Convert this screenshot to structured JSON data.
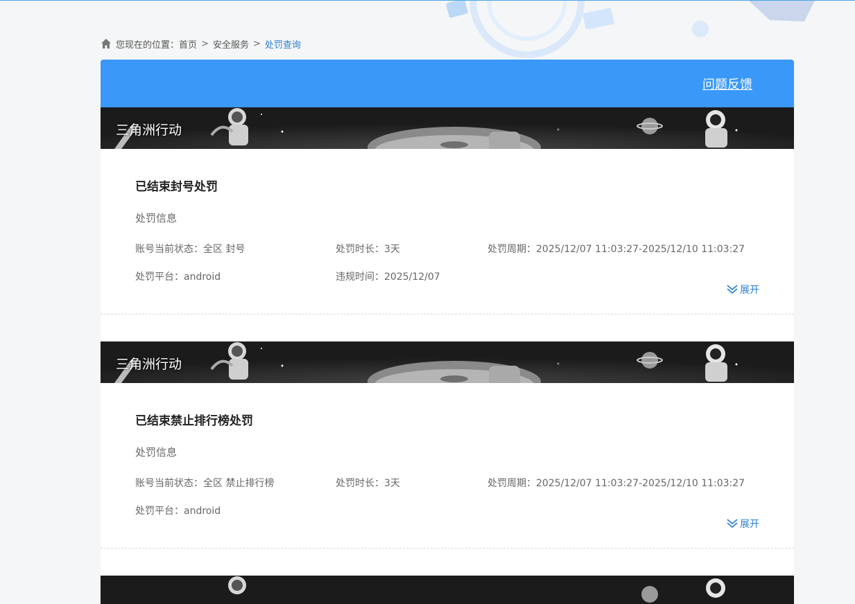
{
  "breadcrumb": {
    "prefix": "您现在的位置：",
    "home": "首页",
    "section": "安全服务",
    "current": "处罚查询",
    "separator": ">"
  },
  "header": {
    "feedback_label": "问题反馈"
  },
  "cards": [
    {
      "game_name": "三角洲行动",
      "title": "已结束封号处罚",
      "subtitle": "处罚信息",
      "status": "账号当前状态：全区 封号",
      "duration": "处罚时长：3天",
      "period": "处罚周期：2025/12/07 11:03:27-2025/12/10 11:03:27",
      "platform": "处罚平台：android",
      "violation_time": "违规时间：2025/12/07",
      "expand_label": "展开"
    },
    {
      "game_name": "三角洲行动",
      "title": "已结束禁止排行榜处罚",
      "subtitle": "处罚信息",
      "status": "账号当前状态：全区 禁止排行榜",
      "duration": "处罚时长：3天",
      "period": "处罚周期：2025/12/07 11:03:27-2025/12/10 11:03:27",
      "platform": "处罚平台：android",
      "expand_label": "展开"
    }
  ],
  "colors": {
    "accent": "#3a98f8",
    "link": "#2d7fd3",
    "banner": "#1b1b1b"
  }
}
